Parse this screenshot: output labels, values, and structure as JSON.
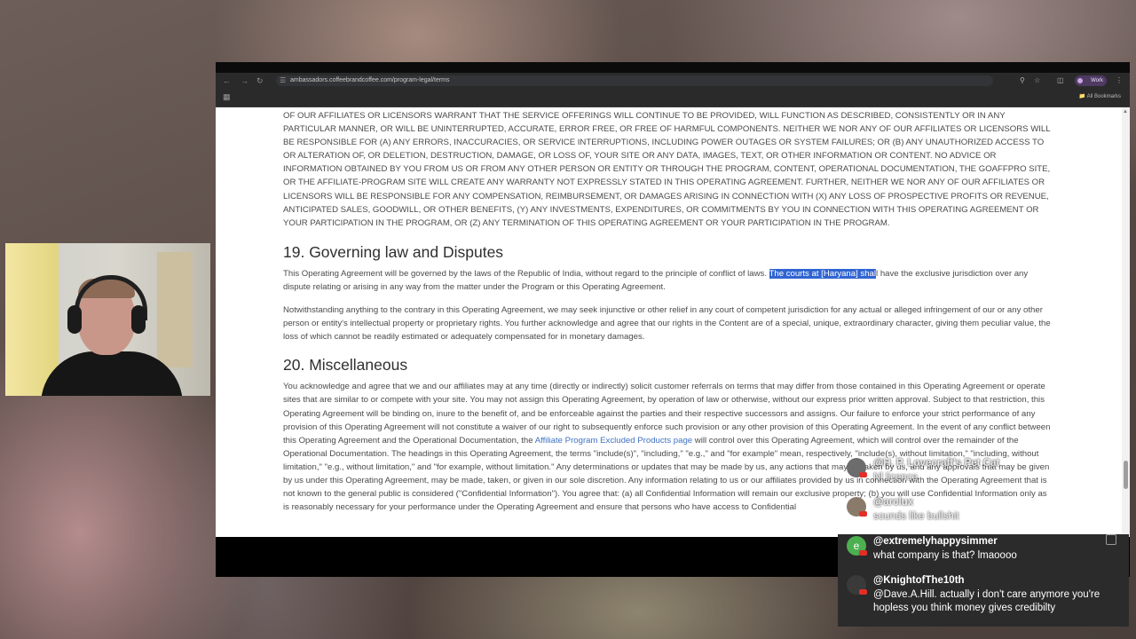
{
  "browser": {
    "url": "ambassadors.coffeebrandcoffee.com/program-legal/terms",
    "profile_label": "Work",
    "all_bookmarks": "All Bookmarks"
  },
  "page": {
    "intro_paragraph": "OF OUR AFFILIATES OR LICENSORS WARRANT THAT THE SERVICE OFFERINGS WILL CONTINUE TO BE PROVIDED, WILL FUNCTION AS DESCRIBED, CONSISTENTLY OR IN ANY PARTICULAR MANNER, OR WILL BE UNINTERRUPTED, ACCURATE, ERROR FREE, OR FREE OF HARMFUL COMPONENTS. NEITHER WE NOR ANY OF OUR AFFILIATES OR LICENSORS WILL BE RESPONSIBLE FOR (A) ANY ERRORS, INACCURACIES, OR SERVICE INTERRUPTIONS, INCLUDING POWER OUTAGES OR SYSTEM FAILURES; OR (B) ANY UNAUTHORIZED ACCESS TO OR ALTERATION OF, OR DELETION, DESTRUCTION, DAMAGE, OR LOSS OF, YOUR SITE OR ANY DATA, IMAGES, TEXT, OR OTHER INFORMATION OR CONTENT. NO ADVICE OR INFORMATION OBTAINED BY YOU FROM US OR FROM ANY OTHER PERSON OR ENTITY OR THROUGH THE PROGRAM, CONTENT, OPERATIONAL DOCUMENTATION, THE GOAFFPRO SITE, OR THE AFFILIATE-PROGRAM SITE WILL CREATE ANY WARRANTY NOT EXPRESSLY STATED IN THIS OPERATING AGREEMENT. FURTHER, NEITHER WE NOR ANY OF OUR AFFILIATES OR LICENSORS WILL BE RESPONSIBLE FOR ANY COMPENSATION, REIMBURSEMENT, OR DAMAGES ARISING IN CONNECTION WITH (X) ANY LOSS OF PROSPECTIVE PROFITS OR REVENUE, ANTICIPATED SALES, GOODWILL, OR OTHER BENEFITS, (Y) ANY INVESTMENTS, EXPENDITURES, OR COMMITMENTS BY YOU IN CONNECTION WITH THIS OPERATING AGREEMENT OR YOUR PARTICIPATION IN THE PROGRAM, OR (Z) ANY TERMINATION OF THIS OPERATING AGREEMENT OR YOUR PARTICIPATION IN THE PROGRAM.",
    "section19_title": "19. Governing law and Disputes",
    "section19_p1_before": "This Operating Agreement will be governed by the laws of the Republic of India, without regard to the principle of conflict of laws. ",
    "section19_p1_highlight": "The courts at [Haryana] shal",
    "section19_p1_after": "l have the exclusive jurisdiction over any dispute relating or arising in any way from the matter under the Program or this Operating Agreement.",
    "section19_p2": "Notwithstanding anything to the contrary in this Operating Agreement, we may seek injunctive or other relief in any court of competent jurisdiction for any actual or alleged infringement of our or any other person or entity's intellectual property or proprietary rights. You further acknowledge and agree that our rights in the Content are of a special, unique, extraordinary character, giving them peculiar value, the loss of which cannot be readily estimated or adequately compensated for in monetary damages.",
    "section20_title": "20. Miscellaneous",
    "section20_p_before": "You acknowledge and agree that we and our affiliates may at any time (directly or indirectly) solicit customer referrals on terms that may differ from those contained in this Operating Agreement or operate sites that are similar to or compete with your site. You may not assign this Operating Agreement, by operation of law or otherwise, without our express prior written approval. Subject to that restriction, this Operating Agreement will be binding on, inure to the benefit of, and be enforceable against the parties and their respective successors and assigns. Our failure to enforce your strict performance of any provision of this Operating Agreement will not constitute a waiver of our right to subsequently enforce such provision or any other provision of this Operating Agreement. In the event of any conflict between this Operating Agreement and the Operational Documentation, the ",
    "section20_link": "Affiliate Program Excluded Products page",
    "section20_p_after": " will control over this Operating Agreement, which will control over the remainder of the Operational Documentation. The headings in this Operating Agreement, the terms \"include(s)\", \"including,\" \"e.g.,\" and \"for example\" mean, respectively, \"include(s), without limitation,\" \"including, without limitation,\" \"e.g., without limitation,\" and \"for example, without limitation.\" Any determinations or updates that may be made by us, any actions that may be taken by us, and any approvals that may be given by us under this Operating Agreement, may be made, taken, or given in our sole discretion. Any information relating to us or our affiliates provided by us in connection with the Operating Agreement that is not known to the general public is considered (\"Confidential Information\"). You agree that: (a) all Confidential Information will remain our exclusive property; (b) you will use Confidential Information only as is reasonably necessary for your performance under the Operating Agreement and ensure that persons who have access to Confidential"
  },
  "chat": {
    "messages": [
      {
        "user": "@H. P. Lovecraft's Pet Cat",
        "text": "Nl licence",
        "avatar_color": "#6c6c6c"
      },
      {
        "user": "@arclux",
        "text": "sounds like bullshit",
        "avatar_color": "#8a7a6a"
      },
      {
        "user": "@extremelyhappysimmer",
        "text": "what company is that? lmaoooo",
        "avatar_color": "#4caf50",
        "avatar_letter": "e"
      },
      {
        "user": "@KnightofThe10th",
        "text": "@Dave.A.Hill. actually i don't care anymore you're hopless you think money gives credibilty",
        "avatar_color": "#3a3a3a"
      }
    ]
  }
}
